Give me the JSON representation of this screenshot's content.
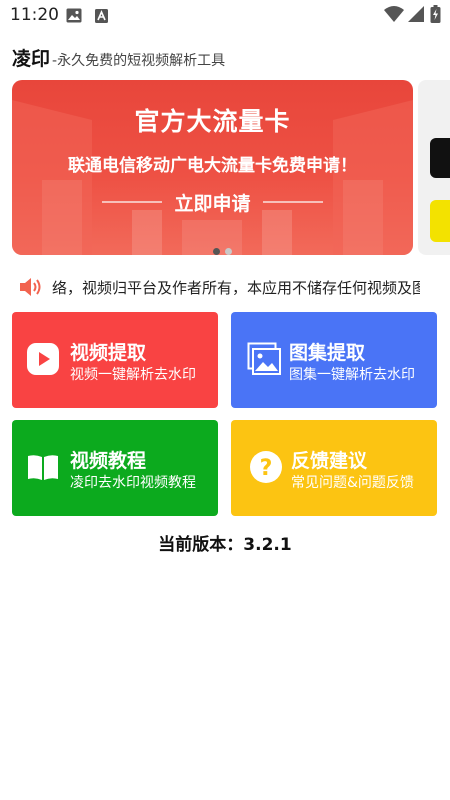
{
  "status_bar": {
    "time": "11:20",
    "icons": [
      "image-icon",
      "a-badge-icon",
      "wifi-icon",
      "signal-icon",
      "battery-charging-icon"
    ]
  },
  "header": {
    "title": "凌印",
    "subtitle": "-永久免费的短视频解析工具"
  },
  "banner": {
    "title": "官方大流量卡",
    "subtitle": "联通电信移动广电大流量卡免费申请！",
    "cta": "立即申请",
    "page_count": 2,
    "active_index": 0
  },
  "notice": {
    "icon": "speaker-icon",
    "text": "络，视频归平台及作者所有，本应用不储存任何视频及图"
  },
  "tiles": [
    {
      "title": "视频提取",
      "desc": "视频一键解析去水印",
      "icon": "play-icon",
      "color": "#f94343"
    },
    {
      "title": "图集提取",
      "desc": "图集一键解析去水印",
      "icon": "gallery-icon",
      "color": "#4a74f6"
    },
    {
      "title": "视频教程",
      "desc": "凌印去水印视频教程",
      "icon": "book-icon",
      "color": "#0caa1e"
    },
    {
      "title": "反馈建议",
      "desc": "常见问题&问题反馈",
      "icon": "question-icon",
      "color": "#fcc412"
    }
  ],
  "version": "当前版本：3.2.1",
  "colors": {
    "banner_red": "#ee5144",
    "notice_icon": "#f2634f"
  }
}
